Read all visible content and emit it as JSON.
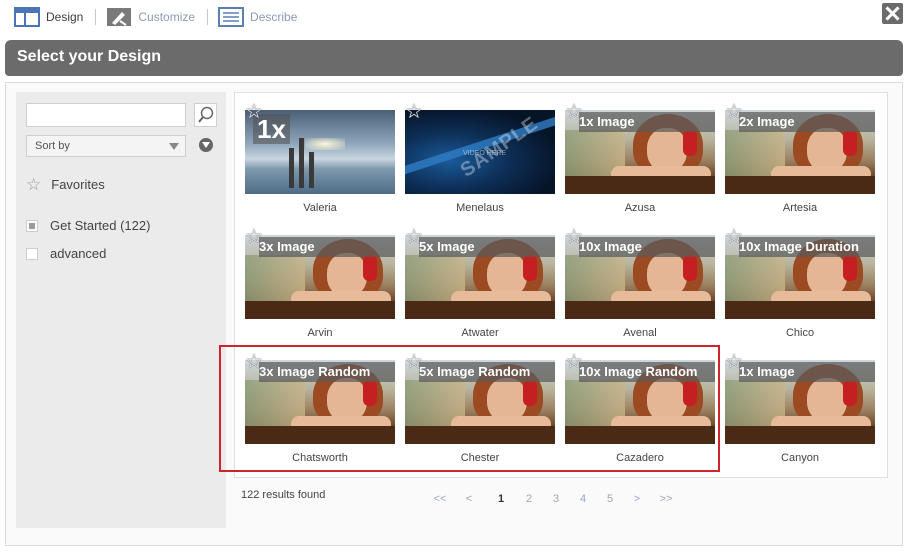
{
  "steps": [
    {
      "label": "Design",
      "icon": "design-layout-icon",
      "active": true
    },
    {
      "label": "Customize",
      "icon": "customize-tools-icon",
      "active": false
    },
    {
      "label": "Describe",
      "icon": "describe-document-icon",
      "active": false
    }
  ],
  "title": "Select your Design",
  "sidebar": {
    "search_value": "",
    "sort_label": "Sort by",
    "favorites_label": "Favorites",
    "filters": [
      {
        "label": "Get Started (122)",
        "checked": true
      },
      {
        "label": "advanced",
        "checked": false
      }
    ]
  },
  "tiles": [
    {
      "name": "Valeria",
      "overlay": "1x",
      "kind": "sea"
    },
    {
      "name": "Menelaus",
      "overlay": "",
      "kind": "blue",
      "watermark": "SAMPLE",
      "watermark_sub": "VIDEO HERE"
    },
    {
      "name": "Azusa",
      "overlay": "1x Image",
      "kind": "photo"
    },
    {
      "name": "Artesia",
      "overlay": "2x Image",
      "kind": "photo"
    },
    {
      "name": "Arvin",
      "overlay": "3x Image",
      "kind": "photo"
    },
    {
      "name": "Atwater",
      "overlay": "5x Image",
      "kind": "photo"
    },
    {
      "name": "Avenal",
      "overlay": "10x Image",
      "kind": "photo"
    },
    {
      "name": "Chico",
      "overlay": "10x Image Duration",
      "kind": "photo"
    },
    {
      "name": "Chatsworth",
      "overlay": "3x Image Random",
      "kind": "photo"
    },
    {
      "name": "Chester",
      "overlay": "5x Image Random",
      "kind": "photo"
    },
    {
      "name": "Cazadero",
      "overlay": "10x Image Random",
      "kind": "photo"
    },
    {
      "name": "Canyon",
      "overlay": "1x Image",
      "kind": "photo",
      "selected": true
    }
  ],
  "results_text": "122 results found",
  "pager": [
    "<<",
    "<",
    "1",
    "2",
    "3",
    "4",
    "5",
    ">",
    ">>"
  ],
  "current_page": "1",
  "colors": {
    "titlebar": "#6b6b6b",
    "highlight": "#d0232a",
    "selected_outline": "#6db8e4",
    "pager_link": "#9aa6c0"
  }
}
